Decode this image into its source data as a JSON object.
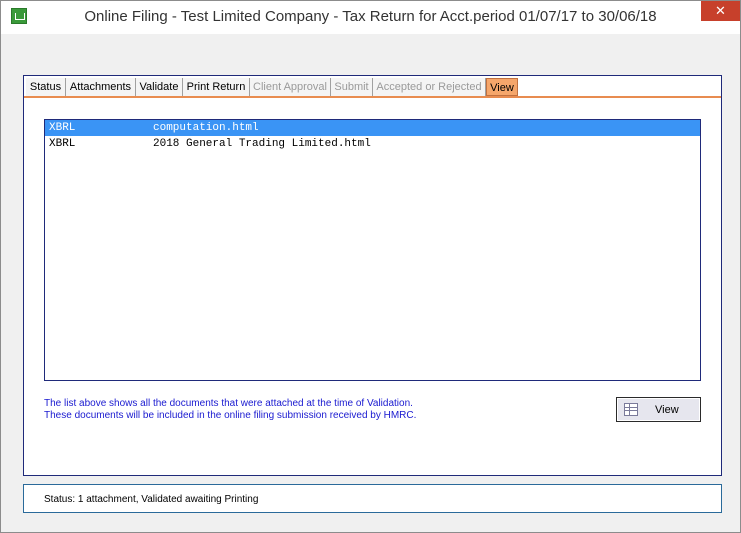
{
  "window": {
    "title": "Online Filing - Test Limited Company - Tax Return for Acct.period 01/07/17 to 30/06/18",
    "close_glyph": "✕"
  },
  "tabs": [
    {
      "label": "Status",
      "state": "enabled"
    },
    {
      "label": "Attachments",
      "state": "enabled"
    },
    {
      "label": "Validate",
      "state": "enabled"
    },
    {
      "label": "Print Return",
      "state": "enabled"
    },
    {
      "label": "Client Approval",
      "state": "disabled"
    },
    {
      "label": "Submit",
      "state": "disabled"
    },
    {
      "label": "Accepted or Rejected",
      "state": "disabled"
    },
    {
      "label": "View",
      "state": "active"
    }
  ],
  "documents": [
    {
      "type": "XBRL",
      "file": "computation.html",
      "selected": true
    },
    {
      "type": "XBRL",
      "file": "2018 General Trading Limited.html",
      "selected": false
    }
  ],
  "info": {
    "line1": "The list above shows all the documents that were attached at the time of Validation.",
    "line2": "These documents will be included in the online filing submission received by HMRC."
  },
  "view_button": {
    "label": "View",
    "icon": "grid-icon"
  },
  "status": {
    "text": "Status: 1 attachment, Validated awaiting Printing"
  },
  "colors": {
    "active_tab": "#f5a66b",
    "selection": "#3a94f5",
    "info_text": "#1a1ad0",
    "close_button": "#c7402b"
  }
}
